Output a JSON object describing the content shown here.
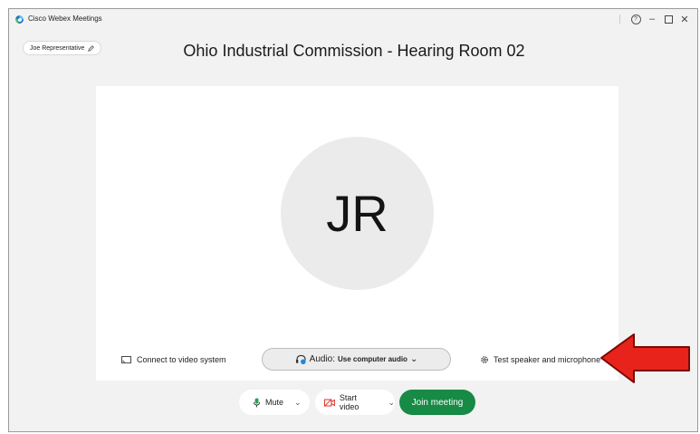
{
  "window": {
    "title": "Cisco Webex Meetings"
  },
  "user": {
    "name": "Joe Representative",
    "initials": "JR"
  },
  "meeting": {
    "title": "Ohio Industrial Commission - Hearing Room 02"
  },
  "controls": {
    "connect_label": "Connect to video system",
    "audio_prefix": "Audio:",
    "audio_value": "Use computer audio",
    "test_label": "Test speaker and microphone",
    "mute_label": "Mute",
    "video_label": "Start video",
    "join_label": "Join meeting"
  },
  "colors": {
    "join": "#178a45",
    "arrow": "#e8231b",
    "video_icon": "#d9342b",
    "mic_icon": "#2aa05a"
  },
  "icons": [
    "webex-logo-icon",
    "help-icon",
    "minimize-icon",
    "maximize-icon",
    "close-icon",
    "edit-icon",
    "cast-icon",
    "headset-icon",
    "chevron-down-icon",
    "gear-icon",
    "microphone-icon",
    "video-off-icon",
    "red-arrow-icon"
  ]
}
